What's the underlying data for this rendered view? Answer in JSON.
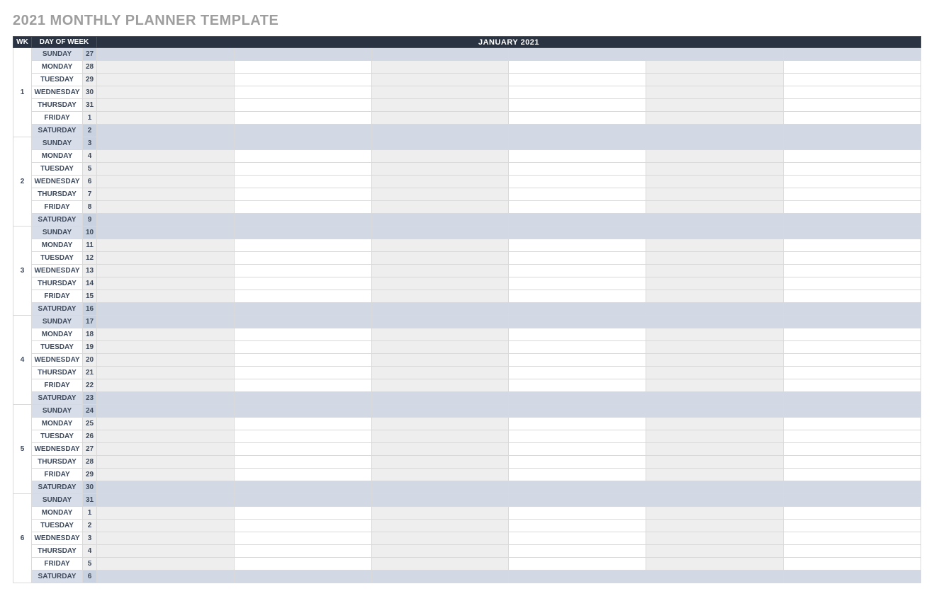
{
  "title": "2021 MONTHLY PLANNER TEMPLATE",
  "headers": {
    "week": "WK",
    "day_of_week": "DAY OF WEEK",
    "month": "JANUARY 2021"
  },
  "event_columns": 6,
  "weeks": [
    {
      "number": "1",
      "days": [
        {
          "dow": "SUNDAY",
          "date": "27",
          "weekend": true
        },
        {
          "dow": "MONDAY",
          "date": "28",
          "weekend": false
        },
        {
          "dow": "TUESDAY",
          "date": "29",
          "weekend": false
        },
        {
          "dow": "WEDNESDAY",
          "date": "30",
          "weekend": false
        },
        {
          "dow": "THURSDAY",
          "date": "31",
          "weekend": false
        },
        {
          "dow": "FRIDAY",
          "date": "1",
          "weekend": false
        },
        {
          "dow": "SATURDAY",
          "date": "2",
          "weekend": true
        }
      ]
    },
    {
      "number": "2",
      "days": [
        {
          "dow": "SUNDAY",
          "date": "3",
          "weekend": true
        },
        {
          "dow": "MONDAY",
          "date": "4",
          "weekend": false
        },
        {
          "dow": "TUESDAY",
          "date": "5",
          "weekend": false
        },
        {
          "dow": "WEDNESDAY",
          "date": "6",
          "weekend": false
        },
        {
          "dow": "THURSDAY",
          "date": "7",
          "weekend": false
        },
        {
          "dow": "FRIDAY",
          "date": "8",
          "weekend": false
        },
        {
          "dow": "SATURDAY",
          "date": "9",
          "weekend": true
        }
      ]
    },
    {
      "number": "3",
      "days": [
        {
          "dow": "SUNDAY",
          "date": "10",
          "weekend": true
        },
        {
          "dow": "MONDAY",
          "date": "11",
          "weekend": false
        },
        {
          "dow": "TUESDAY",
          "date": "12",
          "weekend": false
        },
        {
          "dow": "WEDNESDAY",
          "date": "13",
          "weekend": false
        },
        {
          "dow": "THURSDAY",
          "date": "14",
          "weekend": false
        },
        {
          "dow": "FRIDAY",
          "date": "15",
          "weekend": false
        },
        {
          "dow": "SATURDAY",
          "date": "16",
          "weekend": true
        }
      ]
    },
    {
      "number": "4",
      "days": [
        {
          "dow": "SUNDAY",
          "date": "17",
          "weekend": true
        },
        {
          "dow": "MONDAY",
          "date": "18",
          "weekend": false
        },
        {
          "dow": "TUESDAY",
          "date": "19",
          "weekend": false
        },
        {
          "dow": "WEDNESDAY",
          "date": "20",
          "weekend": false
        },
        {
          "dow": "THURSDAY",
          "date": "21",
          "weekend": false
        },
        {
          "dow": "FRIDAY",
          "date": "22",
          "weekend": false
        },
        {
          "dow": "SATURDAY",
          "date": "23",
          "weekend": true
        }
      ]
    },
    {
      "number": "5",
      "days": [
        {
          "dow": "SUNDAY",
          "date": "24",
          "weekend": true
        },
        {
          "dow": "MONDAY",
          "date": "25",
          "weekend": false
        },
        {
          "dow": "TUESDAY",
          "date": "26",
          "weekend": false
        },
        {
          "dow": "WEDNESDAY",
          "date": "27",
          "weekend": false
        },
        {
          "dow": "THURSDAY",
          "date": "28",
          "weekend": false
        },
        {
          "dow": "FRIDAY",
          "date": "29",
          "weekend": false
        },
        {
          "dow": "SATURDAY",
          "date": "30",
          "weekend": true
        }
      ]
    },
    {
      "number": "6",
      "days": [
        {
          "dow": "SUNDAY",
          "date": "31",
          "weekend": true
        },
        {
          "dow": "MONDAY",
          "date": "1",
          "weekend": false
        },
        {
          "dow": "TUESDAY",
          "date": "2",
          "weekend": false
        },
        {
          "dow": "WEDNESDAY",
          "date": "3",
          "weekend": false
        },
        {
          "dow": "THURSDAY",
          "date": "4",
          "weekend": false
        },
        {
          "dow": "FRIDAY",
          "date": "5",
          "weekend": false
        },
        {
          "dow": "SATURDAY",
          "date": "6",
          "weekend": true
        }
      ]
    }
  ]
}
